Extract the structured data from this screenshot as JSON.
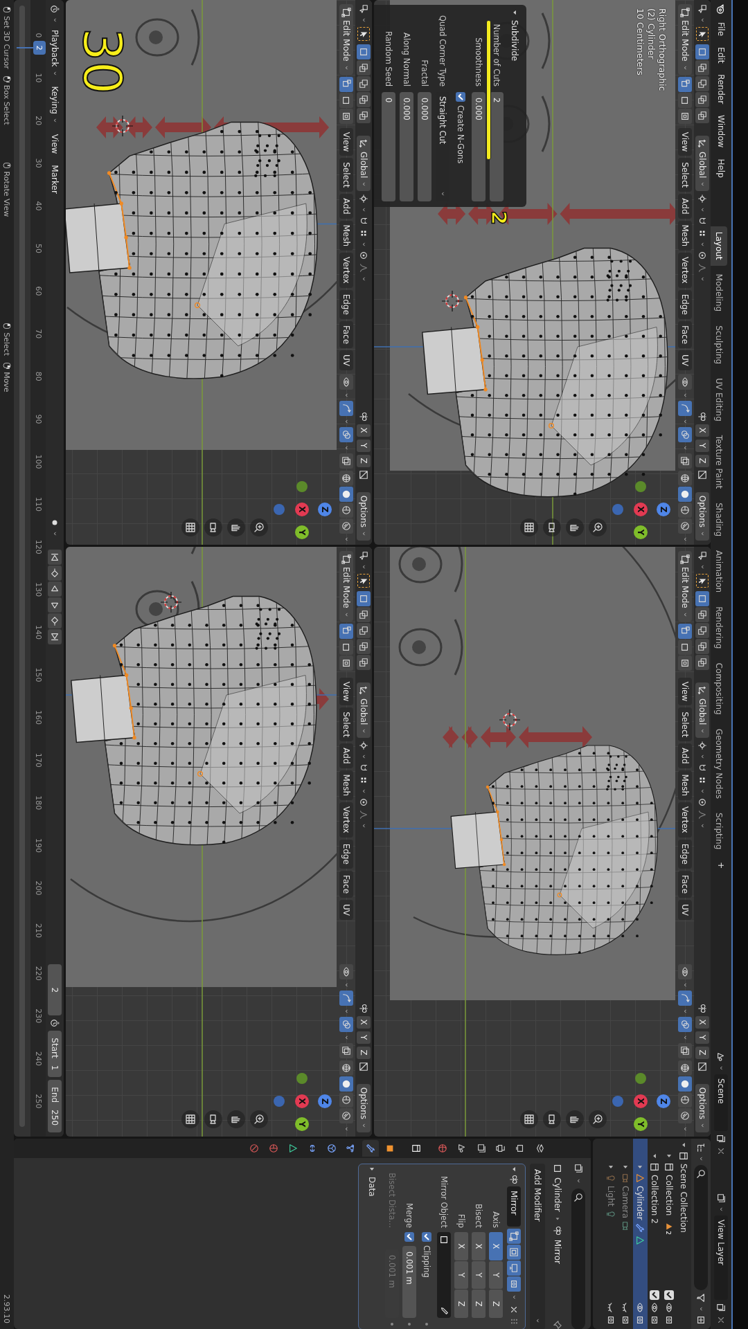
{
  "topbar": {
    "menus": [
      "File",
      "Edit",
      "Render",
      "Window",
      "Help"
    ],
    "workspaces": [
      {
        "label": "Layout",
        "selected": true
      },
      {
        "label": "Modeling",
        "selected": false
      },
      {
        "label": "Sculpting",
        "selected": false
      },
      {
        "label": "UV Editing",
        "selected": false
      },
      {
        "label": "Texture Paint",
        "selected": false
      },
      {
        "label": "Shading",
        "selected": false
      },
      {
        "label": "Animation",
        "selected": false
      },
      {
        "label": "Rendering",
        "selected": false
      },
      {
        "label": "Compositing",
        "selected": false
      },
      {
        "label": "Geometry Nodes",
        "selected": false
      },
      {
        "label": "Scripting",
        "selected": false
      }
    ],
    "add_workspace": "+",
    "scene": "Scene",
    "view_layer": "View Layer"
  },
  "viewports": [
    {
      "orientation": "Global",
      "axes": [
        "X",
        "Y",
        "Z"
      ],
      "options": "Options",
      "mode": "Edit Mode",
      "selection_ops": [
        {
          "kind": "new",
          "selected": true
        },
        {
          "kind": "extend",
          "selected": false
        },
        {
          "kind": "subtract",
          "selected": false
        },
        {
          "kind": "invert",
          "selected": false
        },
        {
          "kind": "intersect",
          "selected": false
        }
      ],
      "select_modes": [
        {
          "kind": "vertex",
          "selected": true
        },
        {
          "kind": "edge",
          "selected": false
        },
        {
          "kind": "face",
          "selected": false
        }
      ],
      "menus": [
        "View",
        "Select",
        "Add",
        "Mesh",
        "Vertex",
        "Edge",
        "Face",
        "UV"
      ],
      "shading": [
        {
          "kind": "wireframe",
          "selected": false
        },
        {
          "kind": "solid",
          "selected": true
        },
        {
          "kind": "material",
          "selected": false
        },
        {
          "kind": "rendered",
          "selected": false
        }
      ],
      "gizmo": [
        "X",
        "Y",
        "Z"
      ],
      "info": [
        "Right Orthographic",
        "(2) Cylinder",
        "10 Centimeters"
      ]
    },
    {
      "orientation": "Global",
      "axes": [
        "X",
        "Y",
        "Z"
      ],
      "options": "Options",
      "mode": "Edit Mode",
      "selection_ops": [
        {
          "kind": "new",
          "selected": true
        },
        {
          "kind": "extend",
          "selected": false
        },
        {
          "kind": "subtract",
          "selected": false
        },
        {
          "kind": "invert",
          "selected": false
        },
        {
          "kind": "intersect",
          "selected": false
        }
      ],
      "select_modes": [
        {
          "kind": "vertex",
          "selected": true
        },
        {
          "kind": "edge",
          "selected": false
        },
        {
          "kind": "face",
          "selected": false
        }
      ],
      "menus": [
        "View",
        "Select",
        "Add",
        "Mesh",
        "Vertex",
        "Edge",
        "Face",
        "UV"
      ],
      "shading": [
        {
          "kind": "wireframe",
          "selected": false
        },
        {
          "kind": "solid",
          "selected": true
        },
        {
          "kind": "material",
          "selected": false
        },
        {
          "kind": "rendered",
          "selected": false
        }
      ],
      "gizmo": [
        "X",
        "Y",
        "Z"
      ]
    },
    {
      "orientation": "Global",
      "axes": [
        "X",
        "Y",
        "Z"
      ],
      "options": "Options",
      "mode": "Edit Mode",
      "selection_ops": [
        {
          "kind": "new",
          "selected": true
        },
        {
          "kind": "extend",
          "selected": false
        },
        {
          "kind": "subtract",
          "selected": false
        },
        {
          "kind": "invert",
          "selected": false
        },
        {
          "kind": "intersect",
          "selected": false
        }
      ],
      "select_modes": [
        {
          "kind": "vertex",
          "selected": true
        },
        {
          "kind": "edge",
          "selected": false
        },
        {
          "kind": "face",
          "selected": false
        }
      ],
      "menus": [
        "View",
        "Select",
        "Add",
        "Mesh",
        "Vertex",
        "Edge",
        "Face",
        "UV"
      ],
      "shading": [
        {
          "kind": "wireframe",
          "selected": false
        },
        {
          "kind": "solid",
          "selected": true
        },
        {
          "kind": "material",
          "selected": false
        },
        {
          "kind": "rendered",
          "selected": false
        }
      ],
      "gizmo": [
        "X",
        "Y",
        "Z"
      ]
    },
    {
      "orientation": "Global",
      "axes": [
        "X",
        "Y",
        "Z"
      ],
      "options": "Options",
      "mode": "Edit Mode",
      "selection_ops": [
        {
          "kind": "new",
          "selected": true
        },
        {
          "kind": "extend",
          "selected": false
        },
        {
          "kind": "subtract",
          "selected": false
        },
        {
          "kind": "invert",
          "selected": false
        },
        {
          "kind": "intersect",
          "selected": false
        }
      ],
      "select_modes": [
        {
          "kind": "vertex",
          "selected": true
        },
        {
          "kind": "edge",
          "selected": false
        },
        {
          "kind": "face",
          "selected": false
        }
      ],
      "menus": [
        "View",
        "Select",
        "Add",
        "Mesh",
        "Vertex",
        "Edge",
        "Face",
        "UV"
      ],
      "shading": [
        {
          "kind": "wireframe",
          "selected": false
        },
        {
          "kind": "solid",
          "selected": true
        },
        {
          "kind": "material",
          "selected": false
        },
        {
          "kind": "rendered",
          "selected": false
        }
      ],
      "gizmo": [
        "X",
        "Y",
        "Z"
      ]
    }
  ],
  "redo_panel": {
    "title": "Subdivide",
    "expanded": true,
    "fields": [
      {
        "kind": "number",
        "label": "Number of Cuts",
        "value": "2"
      },
      {
        "kind": "number",
        "label": "Smoothness",
        "value": "0.000"
      },
      {
        "kind": "checkbox",
        "label": "Create N-Gons",
        "checked": true
      },
      {
        "kind": "dropdown",
        "label": "Quad Corner Type",
        "value": "Straight Cut"
      },
      {
        "kind": "number",
        "label": "Fractal",
        "value": "0.000"
      },
      {
        "kind": "number",
        "label": "Along Normal",
        "value": "0.000"
      },
      {
        "kind": "number",
        "label": "Random Seed",
        "value": "0"
      }
    ]
  },
  "annotations": {
    "step": "30",
    "note": "2"
  },
  "timeline": {
    "dropdowns": [
      "Playback",
      "Keying"
    ],
    "menus": [
      "View",
      "Marker"
    ],
    "ruler": [
      "0",
      "10",
      "20",
      "30",
      "40",
      "50",
      "60",
      "70",
      "80",
      "90",
      "100",
      "110",
      "120",
      "130",
      "140",
      "150",
      "160",
      "170",
      "180",
      "190",
      "200",
      "210",
      "220",
      "230",
      "240",
      "250"
    ],
    "current_frame": "2",
    "frame": "2",
    "start_label": "Start",
    "start": "1",
    "end_label": "End",
    "end": "250"
  },
  "outliner": {
    "tree": [
      {
        "label": "Scene Collection",
        "kind": "scene_collection",
        "selected": false,
        "expanded": true,
        "children": [
          {
            "label": "Collection",
            "kind": "collection",
            "selected": false,
            "expanded": false,
            "enabled": true,
            "hidden": false,
            "count": "2"
          },
          {
            "label": "Collection 2",
            "kind": "collection",
            "selected": false,
            "expanded": true,
            "enabled": true,
            "hidden": false,
            "children": [
              {
                "label": "Cylinder",
                "kind": "mesh",
                "selected": true,
                "expanded": false,
                "hidden": false
              },
              {
                "label": "Camera",
                "kind": "camera",
                "selected": false,
                "expanded": false,
                "hidden": true
              },
              {
                "label": "Light",
                "kind": "light",
                "selected": false,
                "expanded": false,
                "hidden": true
              }
            ]
          }
        ]
      }
    ]
  },
  "properties": {
    "tabs": [
      {
        "kind": "tool",
        "selected": false
      },
      {
        "kind": "render",
        "selected": false
      },
      {
        "kind": "output",
        "selected": false
      },
      {
        "kind": "view_layer",
        "selected": false
      },
      {
        "kind": "scene",
        "selected": false
      },
      {
        "kind": "world",
        "selected": false
      },
      {
        "kind": "collection",
        "selected": false
      },
      {
        "kind": "object",
        "selected": false
      },
      {
        "kind": "modifier",
        "selected": true
      },
      {
        "kind": "particles",
        "selected": false
      },
      {
        "kind": "physics",
        "selected": false
      },
      {
        "kind": "constraints",
        "selected": false
      },
      {
        "kind": "data",
        "selected": false
      },
      {
        "kind": "material",
        "selected": false
      },
      {
        "kind": "texture",
        "selected": false
      }
    ],
    "breadcrumb": [
      "Cylinder",
      "Mirror"
    ],
    "add_modifier": "Add Modifier",
    "modifier": {
      "name": "Mirror",
      "expanded": true,
      "display_toggles": [
        {
          "kind": "edit_mode",
          "on": true
        },
        {
          "kind": "cage",
          "on": true
        },
        {
          "kind": "viewport",
          "on": true
        },
        {
          "kind": "render",
          "on": true
        }
      ],
      "rows": [
        {
          "kind": "toggles",
          "label": "Axis",
          "options": [
            {
              "label": "X",
              "on": true
            },
            {
              "label": "Y",
              "on": false
            },
            {
              "label": "Z",
              "on": false
            }
          ]
        },
        {
          "kind": "toggles",
          "label": "Bisect",
          "options": [
            {
              "label": "X",
              "on": false
            },
            {
              "label": "Y",
              "on": false
            },
            {
              "label": "Z",
              "on": false
            }
          ]
        },
        {
          "kind": "toggles",
          "label": "Flip",
          "options": [
            {
              "label": "X",
              "on": false
            },
            {
              "label": "Y",
              "on": false
            },
            {
              "label": "Z",
              "on": false
            }
          ]
        },
        {
          "kind": "object",
          "label": "Mirror Object"
        },
        {
          "kind": "checkbox",
          "label": "Clipping",
          "checked": true
        },
        {
          "kind": "check_number",
          "label": "Merge",
          "checked": true,
          "value": "0.001 m"
        },
        {
          "kind": "number",
          "label": "Bisect Dista…",
          "value": "0.001 m",
          "disabled": true
        }
      ],
      "subpanels": [
        {
          "label": "Data",
          "expanded": false
        }
      ]
    }
  },
  "status_bar": {
    "groups": [
      [
        {
          "kind": "left",
          "label": "Set 3D Cursor"
        },
        {
          "kind": "left_drag",
          "label": "Box Select"
        }
      ],
      [
        {
          "kind": "middle",
          "label": "Rotate View"
        }
      ],
      [
        {
          "kind": "left",
          "label": "Select"
        },
        {
          "kind": "right_drag",
          "label": "Move"
        }
      ]
    ],
    "version": "2.93.10"
  }
}
